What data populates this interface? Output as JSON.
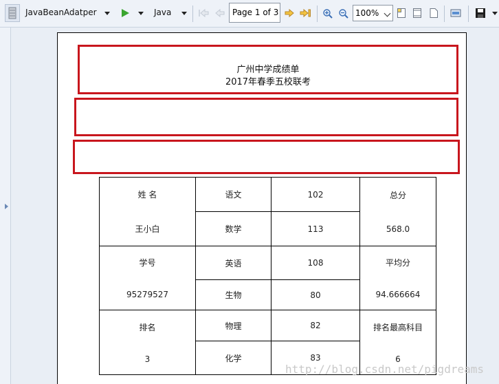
{
  "toolbar": {
    "datasource": "JavaBeanAdatper",
    "language": "Java",
    "page_indicator": "Page 1 of 3",
    "zoom": "100%"
  },
  "report": {
    "title_line1": "广州中学成绩单",
    "title_line2": "2017年春季五校联考"
  },
  "table": {
    "row1": {
      "label": "姓 名",
      "value": "王小白",
      "subj_a": "语文",
      "score_a": "102",
      "subj_b": "数学",
      "score_b": "113",
      "summary_label": "总分",
      "summary_value": "568.0"
    },
    "row2": {
      "label": "学号",
      "value": "95279527",
      "subj_a": "英语",
      "score_a": "108",
      "subj_b": "生物",
      "score_b": "80",
      "summary_label": "平均分",
      "summary_value": "94.666664"
    },
    "row3": {
      "label": "排名",
      "value": "3",
      "subj_a": "物理",
      "score_a": "82",
      "subj_b": "化学",
      "score_b": "83",
      "summary_label": "排名最高科目",
      "summary_value": "6"
    }
  },
  "watermark": "http://blog.csdn.net/pigdreams",
  "colors": {
    "band_border": "#c8161d",
    "run_icon": "#3aa52f",
    "nav_arrow": "#e8b12a"
  }
}
